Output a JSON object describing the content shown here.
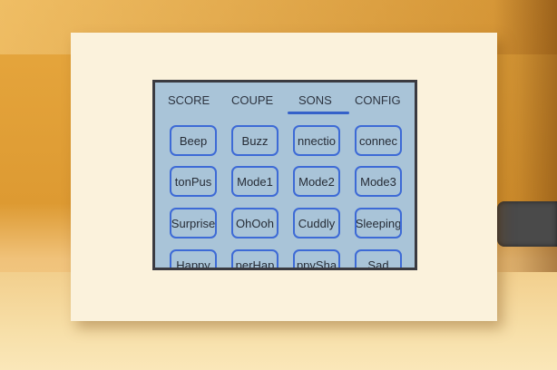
{
  "tabs": [
    "SCORE",
    "COUPE",
    "SONS",
    "CONFIG"
  ],
  "active_tab": "SONS",
  "sound_buttons": [
    [
      "Beep",
      "Buzz",
      "nnectio",
      "connec"
    ],
    [
      "tonPus",
      "Mode1",
      "Mode2",
      "Mode3"
    ],
    [
      "Surprise",
      "OhOoh",
      "Cuddly",
      "Sleeping"
    ],
    [
      "Happy",
      "perHap",
      "ppySha",
      "Sad"
    ]
  ],
  "colors": {
    "screen_bg": "#a9c4d8",
    "button_border": "#3d6ad6",
    "active_underline": "#3561c9"
  }
}
